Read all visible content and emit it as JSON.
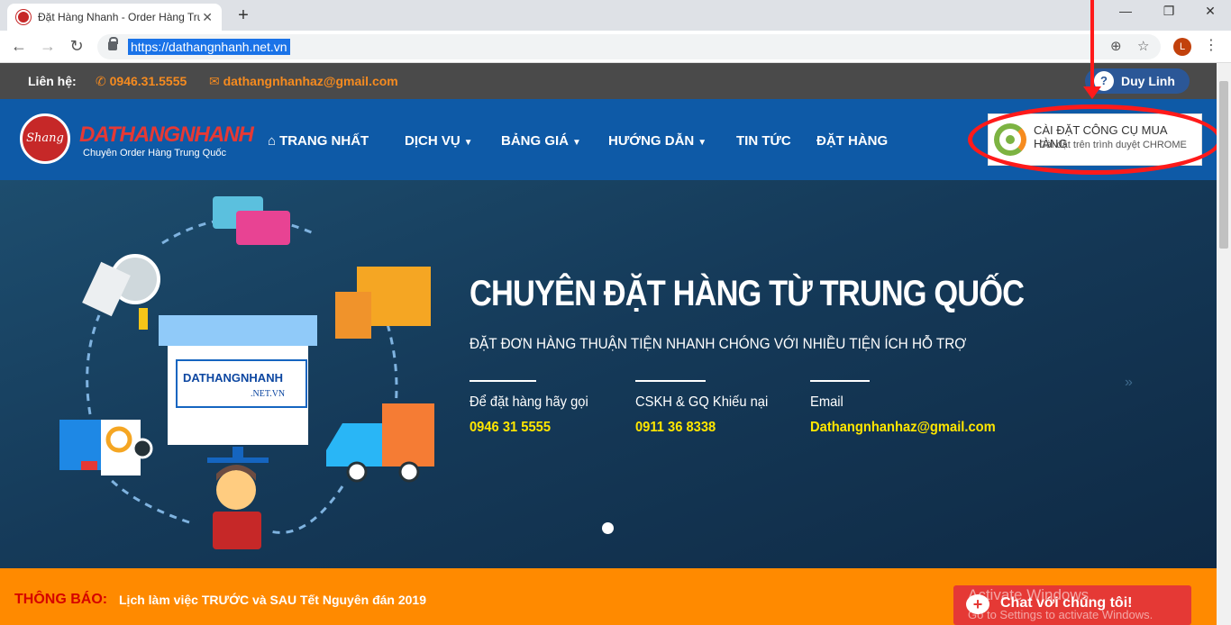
{
  "browser": {
    "tab_title": "Đặt Hàng Nhanh - Order Hàng Trung Quốc",
    "tab_close": "✕",
    "new_tab": "+",
    "url": "https://dathangnhanh.net.vn",
    "profile_initial": "L",
    "window_minimize": "—",
    "window_restore": "❐",
    "window_close": "✕"
  },
  "topbar": {
    "contact_label": "Liên hệ:",
    "phone": "0946.31.5555",
    "email": "dathangnhanhaz@gmail.com",
    "user_name": "Duy Linh"
  },
  "navbar": {
    "brand": "DATHANGNHANH",
    "tagline": "Chuyên Order Hàng Trung Quốc",
    "menu": [
      "TRANG NHẤT",
      "DỊCH VỤ",
      "BẢNG GIÁ",
      "HƯỚNG DẪN",
      "TIN TỨC",
      "ĐẶT HÀNG"
    ],
    "install_title": "CÀI ĐẶT CÔNG CỤ MUA HÀNG",
    "install_sub": "Cài đặt trên trình duyệt CHROME"
  },
  "hero": {
    "title": "CHUYÊN ĐẶT HÀNG TỪ TRUNG QUỐC",
    "subtitle": "ĐẶT ĐƠN HÀNG THUẬN TIỆN NHANH CHÓNG VỚI NHIỀU TIỆN ÍCH HỖ TRỢ",
    "columns": [
      {
        "label": "Để đặt hàng hãy gọi",
        "value": "0946 31 5555"
      },
      {
        "label": "CSKH & GQ Khiếu nại",
        "value": "0911 36 8338"
      },
      {
        "label": "Email",
        "value": "Dathangnhanhaz@gmail.com"
      }
    ],
    "store_sign": "DATHANGNHANH",
    "store_domain": ".NET.VN"
  },
  "notice": {
    "label": "THÔNG BÁO:",
    "text": "Lịch làm việc TRƯỚC và SAU Tết Nguyên đán 2019"
  },
  "chat": {
    "label": "Chat với chúng tôi!"
  },
  "watermark": {
    "line1": "Activate Windows",
    "line2": "Go to Settings to activate Windows."
  },
  "colors": {
    "nav_blue": "#0e5aa7",
    "accent_orange": "#f68b1f",
    "highlight_yellow": "#ffe600",
    "notice_orange": "#ff8a00",
    "annotation_red": "#ff1a1a"
  }
}
